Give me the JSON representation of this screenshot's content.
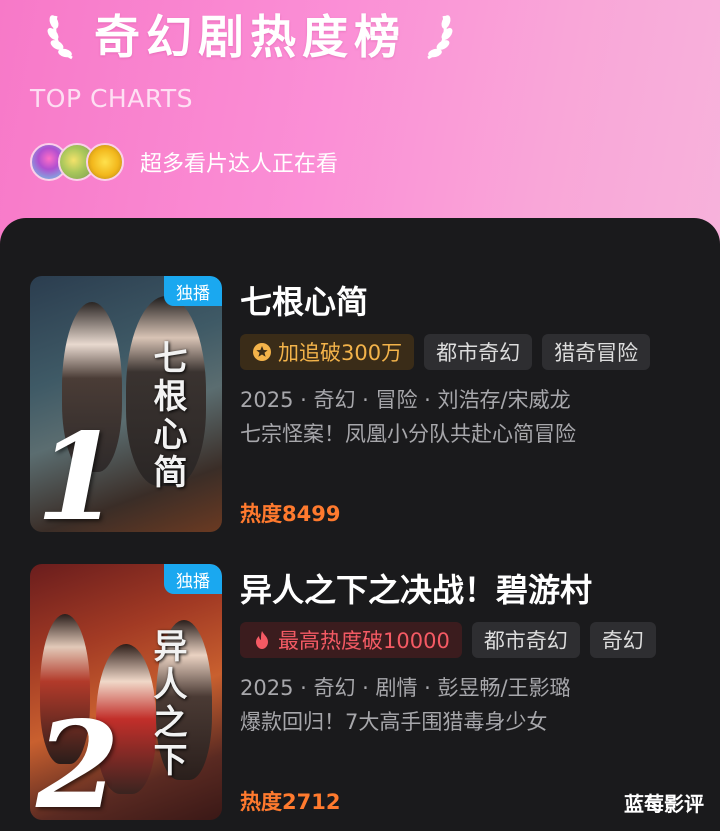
{
  "header": {
    "title": "奇幻剧热度榜",
    "subtitle": "TOP CHARTS",
    "watchers_text": "超多看片达人正在看"
  },
  "items": [
    {
      "rank": "1",
      "badge": "独播",
      "poster_text": "七根心简",
      "title": "七根心简",
      "tags": [
        "加追破300万",
        "都市奇幻",
        "猎奇冒险"
      ],
      "meta": "2025 · 奇幻 · 冒险 · 刘浩存/宋威龙",
      "desc": "七宗怪案！凤凰小分队共赴心简冒险",
      "heat": "热度8499"
    },
    {
      "rank": "2",
      "badge": "独播",
      "poster_text": "异人之下",
      "title": "异人之下之决战！碧游村",
      "tags": [
        "最高热度破10000",
        "都市奇幻",
        "奇幻"
      ],
      "meta": "2025 · 奇幻 · 剧情 · 彭昱畅/王影璐",
      "desc": "爆款回归！7大高手围猎毒身少女",
      "heat": "热度2712"
    }
  ],
  "watermark": "蓝莓影评",
  "colors": {
    "accent_pink": "#f779c8",
    "badge_blue": "#1aa8f0",
    "heat_orange": "#ff7a2e",
    "gold_tag": "#f3b34a",
    "red_tag": "#f45a64"
  },
  "icons": [
    "laurel-left-icon",
    "laurel-right-icon",
    "star-coin-icon",
    "flame-icon"
  ]
}
